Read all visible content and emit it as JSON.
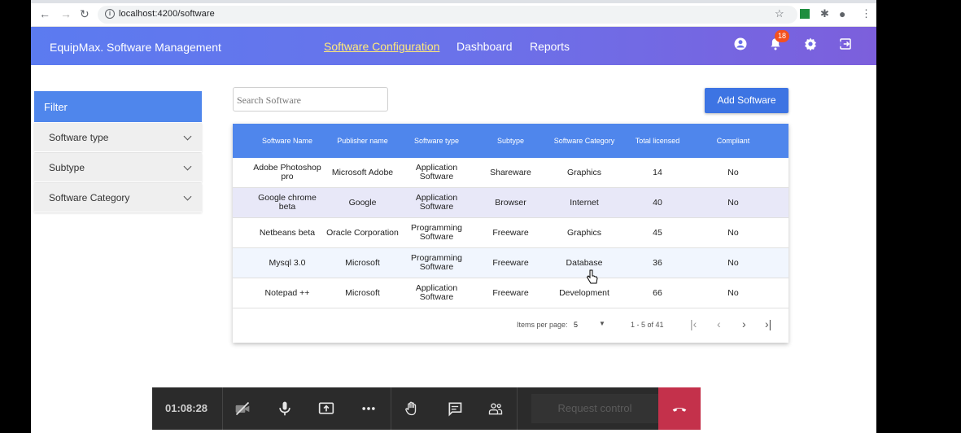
{
  "browser": {
    "url": "localhost:4200/software"
  },
  "header": {
    "brand": "EquipMax. Software Management",
    "nav": [
      "Software Configuration",
      "Dashboard",
      "Reports"
    ],
    "notification_count": "18"
  },
  "filter": {
    "title": "Filter",
    "items": [
      "Software type",
      "Subtype",
      "Software Category"
    ]
  },
  "search": {
    "placeholder": "Search Software"
  },
  "add_button": "Add Software",
  "table": {
    "columns": [
      "Software Name",
      "Publisher name",
      "Software type",
      "Subtype",
      "Software Category",
      "Total licensed",
      "Compliant"
    ],
    "rows": [
      [
        "Adobe Photoshop pro",
        "Microsoft Adobe",
        "Application Software",
        "Shareware",
        "Graphics",
        "14",
        "No"
      ],
      [
        "Google chrome beta",
        "Google",
        "Application Software",
        "Browser",
        "Internet",
        "40",
        "No"
      ],
      [
        "Netbeans beta",
        "Oracle Corporation",
        "Programming Software",
        "Freeware",
        "Graphics",
        "45",
        "No"
      ],
      [
        "Mysql 3.0",
        "Microsoft",
        "Programming Software",
        "Freeware",
        "Database",
        "36",
        "No"
      ],
      [
        "Notepad ++",
        "Microsoft",
        "Application Software",
        "Freeware",
        "Development",
        "66",
        "No"
      ]
    ]
  },
  "pager": {
    "items_label": "Items per page:",
    "page_size": "5",
    "range": "1 - 5 of 41"
  },
  "meeting": {
    "time": "01:08:28",
    "request_control": "Request control"
  },
  "colors": {
    "header_start": "#5b7bf0",
    "header_end": "#7c5fdc",
    "primary": "#4f86ec",
    "hangup": "#c4314b",
    "badge": "#f4511e"
  }
}
